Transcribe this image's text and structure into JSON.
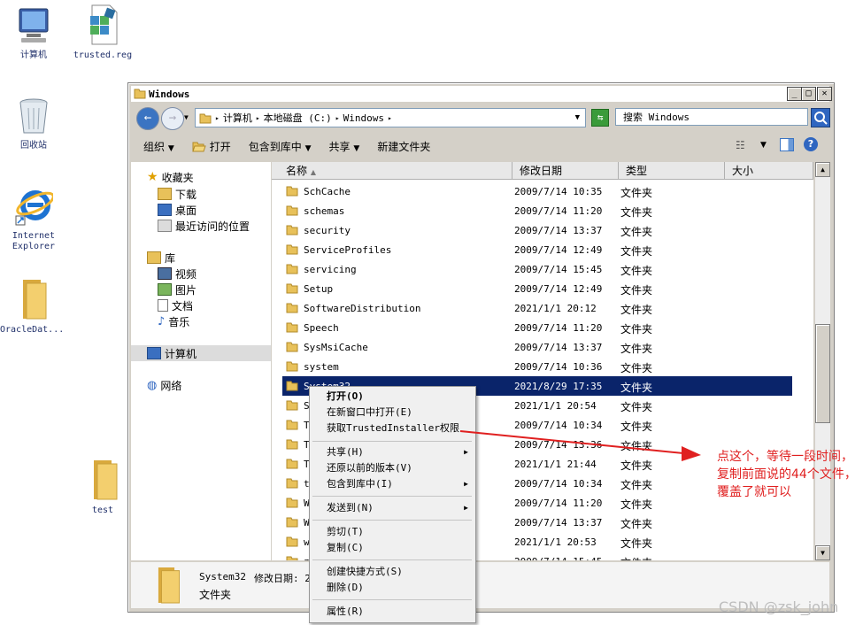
{
  "desktop": {
    "icons": [
      {
        "label": "计算机"
      },
      {
        "label": "trusted.reg"
      },
      {
        "label": "回收站"
      },
      {
        "label": "Internet Explorer"
      },
      {
        "label": "OracleDat..."
      },
      {
        "label": "test"
      }
    ]
  },
  "window": {
    "title": "Windows",
    "address": {
      "crumbs": [
        "计算机",
        "本地磁盘 (C:)",
        "Windows"
      ]
    },
    "search": {
      "placeholder": "搜索 Windows"
    },
    "toolbar": {
      "organize": "组织",
      "open": "打开",
      "include_in_library": "包含到库中",
      "share": "共享",
      "new_folder": "新建文件夹"
    },
    "nav": {
      "favorites": "收藏夹",
      "downloads": "下载",
      "desktop": "桌面",
      "recent": "最近访问的位置",
      "libraries": "库",
      "videos": "视频",
      "pictures": "图片",
      "documents": "文档",
      "music": "音乐",
      "computer": "计算机",
      "network": "网络"
    },
    "columns": {
      "name": "名称",
      "date": "修改日期",
      "type": "类型",
      "size": "大小"
    },
    "rows": [
      {
        "name": "SchCache",
        "date": "2009/7/14 10:35",
        "type": "文件夹"
      },
      {
        "name": "schemas",
        "date": "2009/7/14 11:20",
        "type": "文件夹"
      },
      {
        "name": "security",
        "date": "2009/7/14 13:37",
        "type": "文件夹"
      },
      {
        "name": "ServiceProfiles",
        "date": "2009/7/14 12:49",
        "type": "文件夹"
      },
      {
        "name": "servicing",
        "date": "2009/7/14 15:45",
        "type": "文件夹"
      },
      {
        "name": "Setup",
        "date": "2009/7/14 12:49",
        "type": "文件夹"
      },
      {
        "name": "SoftwareDistribution",
        "date": "2021/1/1 20:12",
        "type": "文件夹"
      },
      {
        "name": "Speech",
        "date": "2009/7/14 11:20",
        "type": "文件夹"
      },
      {
        "name": "SysMsiCache",
        "date": "2009/7/14 13:37",
        "type": "文件夹"
      },
      {
        "name": "system",
        "date": "2009/7/14 10:36",
        "type": "文件夹"
      },
      {
        "name": "System32",
        "date": "2021/8/29 17:35",
        "type": "文件夹",
        "selected": true
      },
      {
        "name": "S",
        "date": "2021/1/1 20:54",
        "type": "文件夹"
      },
      {
        "name": "T",
        "date": "2009/7/14 10:34",
        "type": "文件夹"
      },
      {
        "name": "T",
        "date": "2009/7/14 13:36",
        "type": "文件夹"
      },
      {
        "name": "T",
        "date": "2021/1/1 21:44",
        "type": "文件夹"
      },
      {
        "name": "t",
        "date": "2009/7/14 10:34",
        "type": "文件夹"
      },
      {
        "name": "W",
        "date": "2009/7/14 11:20",
        "type": "文件夹"
      },
      {
        "name": "W",
        "date": "2009/7/14 13:37",
        "type": "文件夹"
      },
      {
        "name": "w",
        "date": "2021/1/1 20:53",
        "type": "文件夹"
      },
      {
        "name": "z",
        "date": "2009/7/14 15:45",
        "type": "文件夹"
      }
    ],
    "details": {
      "name": "System32",
      "date_label": "修改日期: 2",
      "type": "文件夹"
    }
  },
  "context_menu": {
    "items": [
      {
        "label": "打开(O)"
      },
      {
        "label": "在新窗口中打开(E)"
      },
      {
        "label": "获取TrustedInstaller权限"
      },
      {
        "label": "共享(H)"
      },
      {
        "label": "还原以前的版本(V)"
      },
      {
        "label": "包含到库中(I)"
      },
      {
        "label": "发送到(N)"
      },
      {
        "label": "剪切(T)"
      },
      {
        "label": "复制(C)"
      },
      {
        "label": "创建快捷方式(S)"
      },
      {
        "label": "删除(D)"
      },
      {
        "label": "属性(R)"
      }
    ]
  },
  "annotation": {
    "text": "点这个，等待一段时间，复制前面说的44个文件，覆盖了就可以"
  },
  "watermark": "CSDN @zsk_john",
  "colors": {
    "selection": "#0a246a",
    "annotation": "#e02020",
    "folder": "#e8c15a"
  }
}
